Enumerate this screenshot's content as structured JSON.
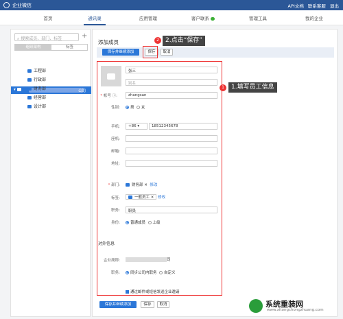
{
  "topbar": {
    "brand": "企业微信",
    "links": [
      "API文档",
      "联系客服",
      "退出"
    ]
  },
  "nav": {
    "items": [
      "首页",
      "通讯录",
      "应用管理",
      "客户联系",
      "管理工具",
      "我的企业"
    ],
    "active": 1
  },
  "sidebar": {
    "search_placeholder": "搜索成员、部门、标签",
    "tabs": [
      "组织架构",
      "标签"
    ],
    "root_suffix": "公司",
    "departments": [
      "工程部",
      "行政部",
      "财务部",
      "经营部",
      "设计部"
    ]
  },
  "main": {
    "title": "添加成员",
    "buttons": {
      "save_continue": "保存并继续添加",
      "save": "保存",
      "cancel": "取消"
    },
    "callouts": {
      "save": {
        "num": "2",
        "text": "2.点击“保存”"
      },
      "fill": {
        "num": "1",
        "text": "1.填写员工信息"
      }
    },
    "form": {
      "name": "张三",
      "alias_placeholder": "别名",
      "account_label": "帐号",
      "account": "zhangsan",
      "gender_label": "性别:",
      "gender_options": [
        "男",
        "女"
      ],
      "phone_label": "手机:",
      "phone_code": "+86",
      "phone": "18512345678",
      "tel_label": "座机:",
      "email_label": "邮箱:",
      "address_label": "地址:",
      "dept_label": "部门:",
      "dept_value": "财务部",
      "modify": "修改",
      "tag_label": "标签:",
      "tag_value": "一般员工",
      "title_label": "职务:",
      "title_value": "职员",
      "identity_label": "身份:",
      "identity_options": [
        "普通成员",
        "上级"
      ],
      "external_title": "对外信息",
      "corp_label": "企业简称:",
      "corp_suffix": "司",
      "job_label": "职务:",
      "job_options": [
        "同步公司内职务",
        "自定义"
      ],
      "invite_text": "通过邮件或短信发送企业邀请"
    }
  },
  "watermark": {
    "text": "系统重装网",
    "url": "www.xitongchongzhuang.com"
  }
}
